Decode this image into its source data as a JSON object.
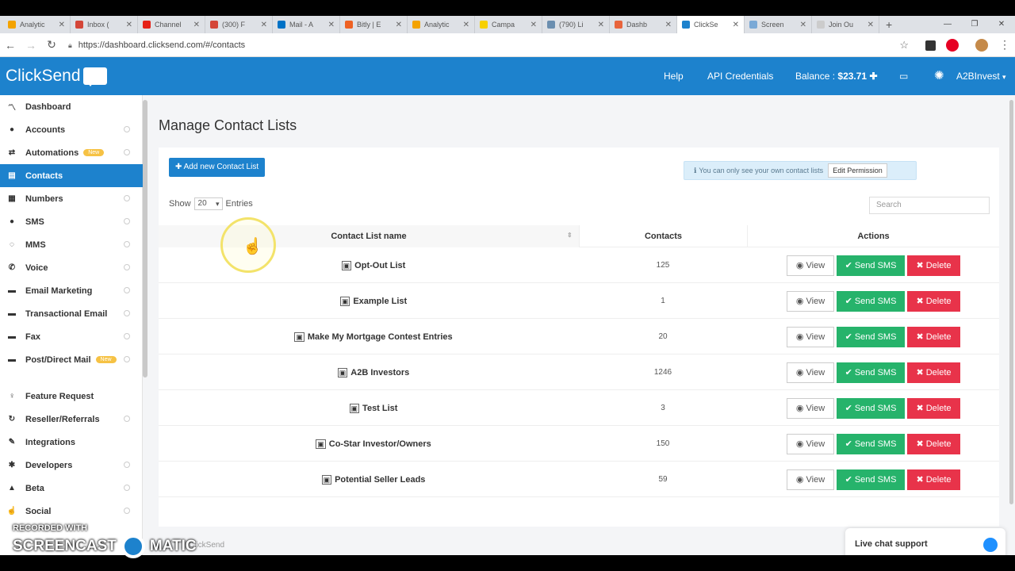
{
  "browser": {
    "tabs": [
      {
        "title": "Analytic",
        "color": "#f4a300"
      },
      {
        "title": "Inbox (",
        "color": "#d44638"
      },
      {
        "title": "Channel",
        "color": "#e62117"
      },
      {
        "title": "(300) F",
        "color": "#d44638"
      },
      {
        "title": "Mail - A",
        "color": "#0072c6"
      },
      {
        "title": "Bitly | E",
        "color": "#ee6123"
      },
      {
        "title": "Analytic",
        "color": "#f4a300"
      },
      {
        "title": "Campa",
        "color": "#f7d000"
      },
      {
        "title": "(790) Li",
        "color": "#6b8fb0"
      },
      {
        "title": "Dashb",
        "color": "#e8643c"
      },
      {
        "title": "ClickSe",
        "color": "#1d82cd"
      },
      {
        "title": "Screen",
        "color": "#7aa9d6"
      },
      {
        "title": "Join Ou",
        "color": "#cccccc"
      }
    ],
    "url": "https://dashboard.clicksend.com/#/contacts"
  },
  "header": {
    "logo": "ClickSend",
    "help": "Help",
    "api": "API Credentials",
    "balance_label": "Balance :",
    "balance_value": "$23.71",
    "account": "A2BInvest"
  },
  "sidebar": {
    "items": [
      {
        "label": "Dashboard",
        "icon": "chart-icon",
        "glyph": "〽",
        "dot": false,
        "badge": ""
      },
      {
        "label": "Accounts",
        "icon": "user-icon",
        "glyph": "●",
        "dot": true,
        "badge": ""
      },
      {
        "label": "Automations",
        "icon": "automation-icon",
        "glyph": "⇄",
        "dot": true,
        "badge": "New"
      },
      {
        "label": "Contacts",
        "icon": "contacts-icon",
        "glyph": "▤",
        "dot": false,
        "badge": ""
      },
      {
        "label": "Numbers",
        "icon": "numbers-icon",
        "glyph": "▦",
        "dot": true,
        "badge": ""
      },
      {
        "label": "SMS",
        "icon": "sms-icon",
        "glyph": "●",
        "dot": true,
        "badge": ""
      },
      {
        "label": "MMS",
        "icon": "mms-icon",
        "glyph": "◌",
        "dot": true,
        "badge": ""
      },
      {
        "label": "Voice",
        "icon": "phone-icon",
        "glyph": "✆",
        "dot": true,
        "badge": ""
      },
      {
        "label": "Email Marketing",
        "icon": "email-icon",
        "glyph": "▬",
        "dot": true,
        "badge": ""
      },
      {
        "label": "Transactional Email",
        "icon": "email-icon",
        "glyph": "▬",
        "dot": true,
        "badge": ""
      },
      {
        "label": "Fax",
        "icon": "fax-icon",
        "glyph": "▬",
        "dot": true,
        "badge": ""
      },
      {
        "label": "Post/Direct Mail",
        "icon": "mail-icon",
        "glyph": "▬",
        "dot": true,
        "badge": "New"
      },
      {
        "label": "Feature Request",
        "icon": "lightbulb-icon",
        "glyph": "♀",
        "dot": false,
        "badge": ""
      },
      {
        "label": "Reseller/Referrals",
        "icon": "referral-icon",
        "glyph": "↻",
        "dot": true,
        "badge": ""
      },
      {
        "label": "Integrations",
        "icon": "plug-icon",
        "glyph": "✎",
        "dot": false,
        "badge": ""
      },
      {
        "label": "Developers",
        "icon": "code-icon",
        "glyph": "✱",
        "dot": true,
        "badge": ""
      },
      {
        "label": "Beta",
        "icon": "flask-icon",
        "glyph": "▲",
        "dot": true,
        "badge": ""
      },
      {
        "label": "Social",
        "icon": "thumbs-up-icon",
        "glyph": "☝",
        "dot": true,
        "badge": ""
      }
    ]
  },
  "main": {
    "title": "Manage Contact Lists",
    "add_button": "Add new Contact List",
    "info": "You can only see your own contact lists",
    "permission": "Edit Permission",
    "show": "Show",
    "entries_value": "20",
    "entries": "Entries",
    "search_placeholder": "Search",
    "columns": {
      "name": "Contact List name",
      "contacts": "Contacts",
      "actions": "Actions"
    },
    "rows": [
      {
        "name": "Opt-Out List",
        "contacts": "125"
      },
      {
        "name": "Example List",
        "contacts": "1"
      },
      {
        "name": "Make My Mortgage Contest Entries",
        "contacts": "20"
      },
      {
        "name": "A2B Investors",
        "contacts": "1246"
      },
      {
        "name": "Test List",
        "contacts": "3"
      },
      {
        "name": "Co-Star Investor/Owners",
        "contacts": "150"
      },
      {
        "name": "Potential Seller Leads",
        "contacts": "59"
      }
    ],
    "action_labels": {
      "view": "View",
      "send": "Send SMS",
      "delete": "Delete"
    }
  },
  "footer": {
    "text": "ClickSend"
  },
  "chat": {
    "label": "Live chat support"
  },
  "watermark": {
    "line1": "RECORDED WITH",
    "left": "SCREENCAST",
    "right": "MATIC"
  }
}
